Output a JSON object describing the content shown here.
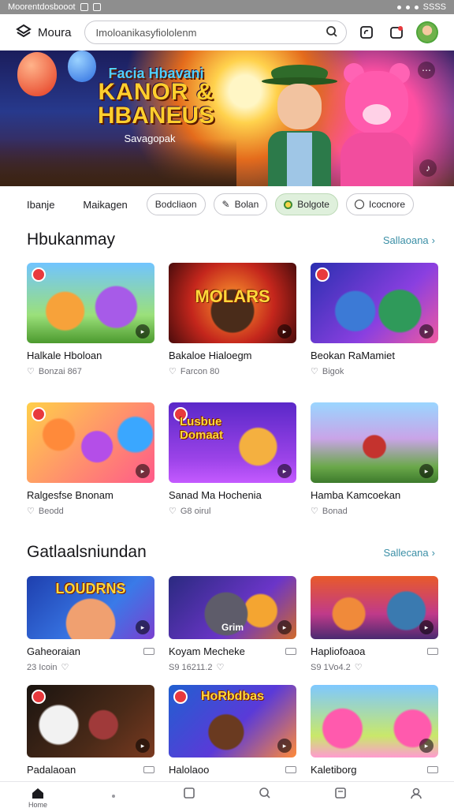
{
  "status_bar": {
    "left_text": "Moorentdosbooot",
    "right_text": "SSSS"
  },
  "app": {
    "name": "Moura"
  },
  "search": {
    "value": "Imoloanikasyfiololenm"
  },
  "hero": {
    "line1": "Facia Hbavani",
    "line2": "KANOR &",
    "line3": "HBANEUS",
    "tagline": "Savagopak"
  },
  "chips": {
    "tabs": [
      "Ibanje",
      "Maikagen"
    ],
    "items": [
      {
        "label": "Bodcliaon",
        "icon": "none",
        "selected": false
      },
      {
        "label": "Bolan",
        "icon": "pencil-icon",
        "selected": false
      },
      {
        "label": "Bolgote",
        "icon": "badge-icon",
        "selected": true
      },
      {
        "label": "Icocnore",
        "icon": "chat-icon",
        "selected": false
      }
    ]
  },
  "section1": {
    "title": "Hbukanmay",
    "link": "Sallaoana",
    "cards": [
      {
        "title": "Halkale Hboloan",
        "meta": "Bonzai 867",
        "thumb_text": ""
      },
      {
        "title": "Bakaloe Hialoegm",
        "meta": "Farcon 80",
        "thumb_text": "MOLARS"
      },
      {
        "title": "Beokan RaMamiet",
        "meta": "Bigok",
        "thumb_text": ""
      },
      {
        "title": "Ralgesfse Bnonam",
        "meta": "Beodd",
        "thumb_text": ""
      },
      {
        "title": "Sanad Ma Hochenia",
        "meta": "G8 oirul",
        "thumb_text": "Lusbue Domaat"
      },
      {
        "title": "Hamba Kamcoekan",
        "meta": "Bonad",
        "thumb_text": ""
      }
    ]
  },
  "section2": {
    "title": "Gatlaalsniundan",
    "link": "Sallecana",
    "cards": [
      {
        "title": "Gaheoraian",
        "meta": "23 Icoin",
        "thumb_text": "LOUDRNS"
      },
      {
        "title": "Koyam Mecheke",
        "meta": "S9 16211.2",
        "thumb_text": "Grim"
      },
      {
        "title": "Hapliofoaoa",
        "meta": "S9 1Vo4.2",
        "thumb_text": ""
      },
      {
        "title": "Padalaoan",
        "meta": "",
        "thumb_text": ""
      },
      {
        "title": "Halolaoo",
        "meta": "",
        "thumb_text": "HoRbdbas"
      },
      {
        "title": "Kaletiborg",
        "meta": "",
        "thumb_text": ""
      }
    ]
  },
  "bottom_nav": [
    "Home",
    "",
    "",
    "",
    "",
    ""
  ],
  "colors": {
    "accent": "#3b8fa6",
    "chip_selected": "#dff0dc"
  }
}
